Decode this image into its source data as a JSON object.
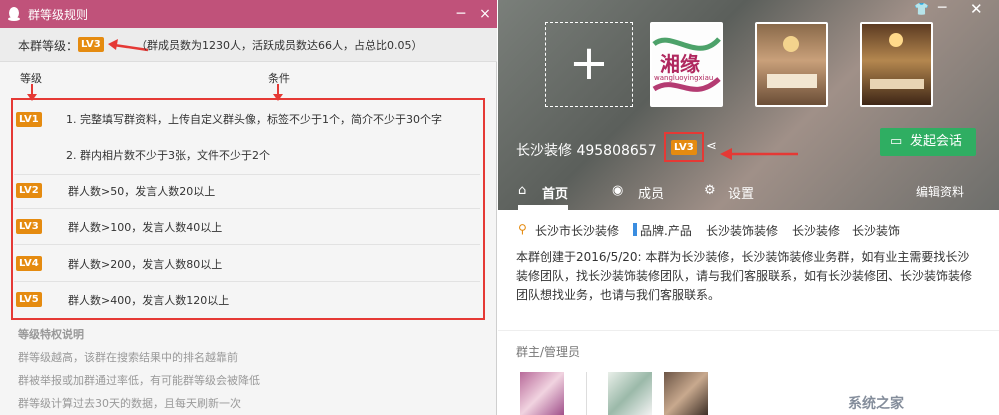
{
  "left": {
    "title": "群等级规则",
    "close": "×",
    "group_level_label": "本群等级：",
    "group_level_badge": "LV3",
    "group_level_info": "（群成员数为1230人，活跃成员数达66人，占总比0.05）",
    "col_level": "等级",
    "col_condition": "条件",
    "levels": [
      {
        "badge": "LV1",
        "lines": [
          "1. 完整填写群资料，上传自定义群头像，标签不少于1个，简介不少于30个字",
          "2. 群内相片数不少于3张，文件不少于2个"
        ]
      },
      {
        "badge": "LV2",
        "lines": [
          "群人数>50，发言人数20以上"
        ]
      },
      {
        "badge": "LV3",
        "lines": [
          "群人数>100，发言人数40以上"
        ]
      },
      {
        "badge": "LV4",
        "lines": [
          "群人数>200，发言人数80以上"
        ]
      },
      {
        "badge": "LV5",
        "lines": [
          "群人数>400，发言人数120以上"
        ]
      }
    ],
    "privileges_title": "等级特权说明",
    "notes": [
      "群等级越高，该群在搜索结果中的排名越靠前",
      "群被举报或加群通过率低，有可能群等级会被降低",
      "群等级计算过去30天的数据，且每天刷新一次"
    ]
  },
  "right": {
    "group_name": "长沙装修 495808657",
    "group_badge": "LV3",
    "start_chat": "发起会话",
    "photo1_text": "湘缘",
    "photo1_sub": "wangluoyingxiau",
    "tabs": [
      "首页",
      "成员",
      "设置"
    ],
    "edit_profile": "编辑资料",
    "location": "长沙市长沙装修",
    "tags": [
      "品牌.产品",
      "长沙装饰装修",
      "长沙装修",
      "长沙装饰"
    ],
    "description": "本群创建于2016/5/20: 本群为长沙装修，长沙装饰装修业务群，如有业主需要找长沙装修团队，找长沙装饰装修团队，请与我们客服联系，如有长沙装修团、长沙装饰装修团队想找业务，也请与我们客服联系。",
    "admins_label": "群主/管理员",
    "watermark": "系统之家"
  }
}
